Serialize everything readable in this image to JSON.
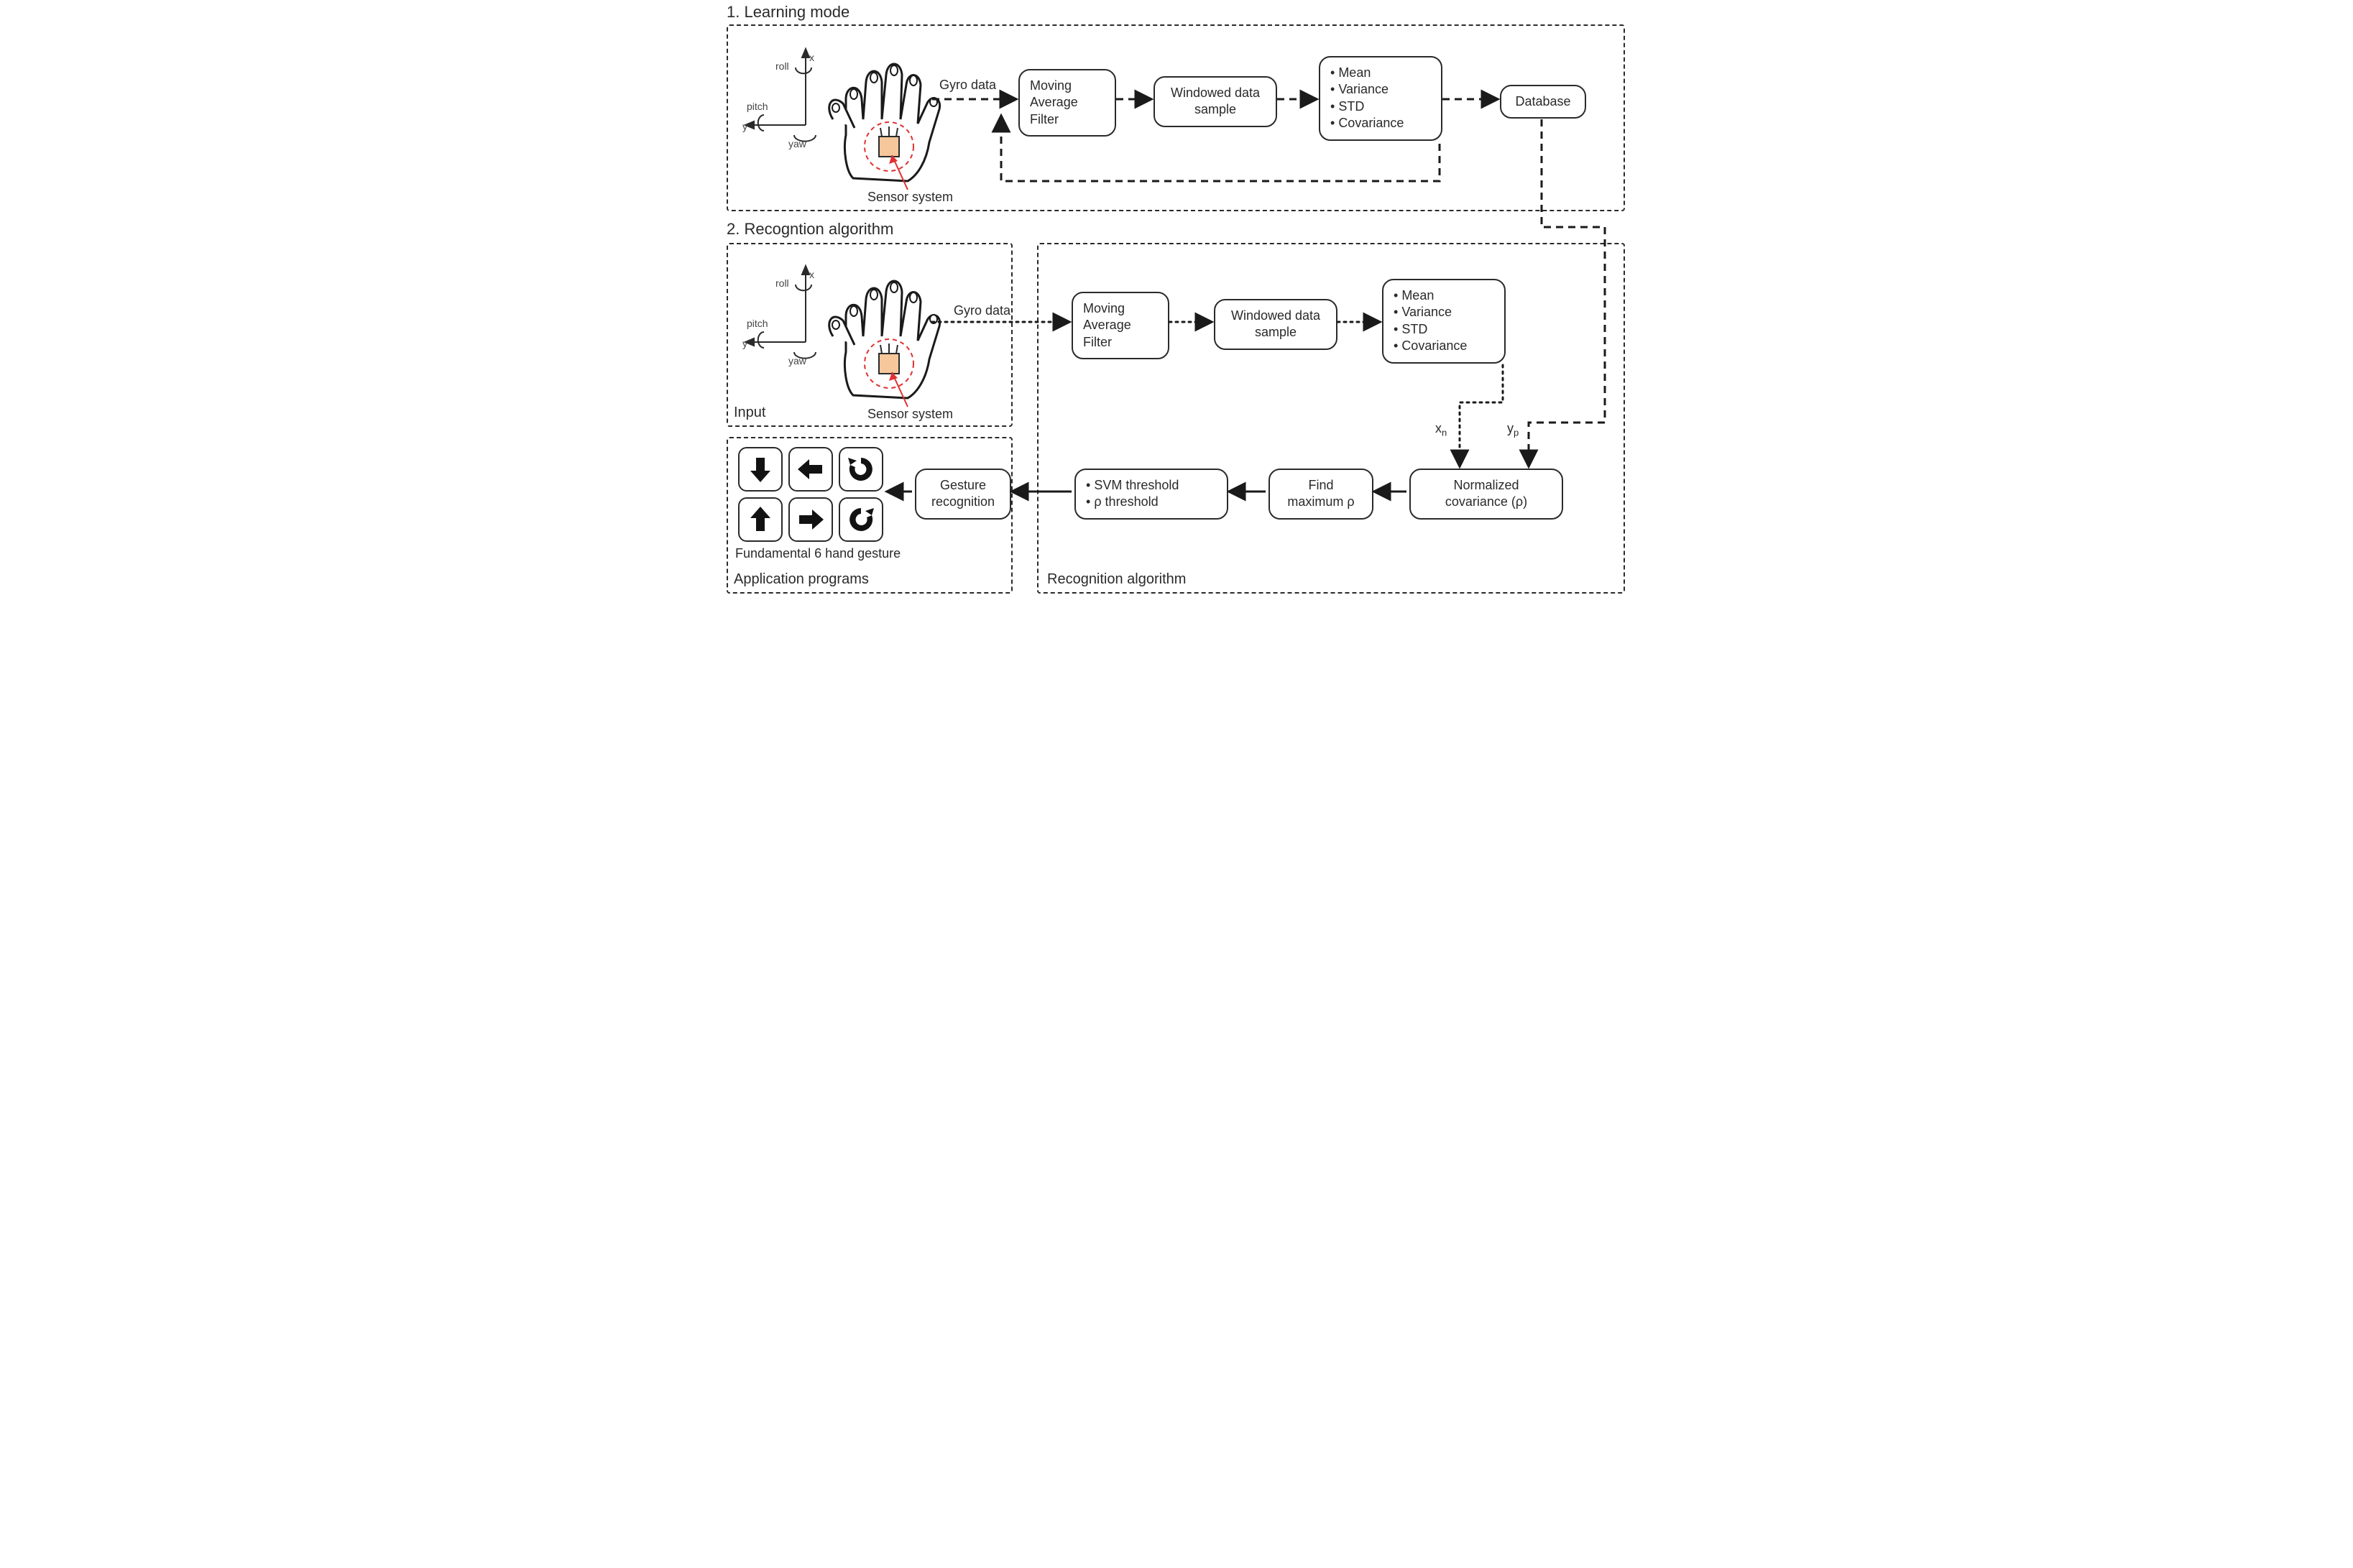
{
  "section1_title": "1. Learning mode",
  "section2_title": "2. Recogntion algorithm",
  "axis": {
    "x": "x",
    "y": "y",
    "roll": "roll",
    "pitch": "pitch",
    "yaw": "yaw"
  },
  "sensor_system_label": "Sensor system",
  "gyro_data_label": "Gyro data",
  "maf_box": "Moving Average Filter",
  "windowed_box": "Windowed data sample",
  "features_box": {
    "mean": "Mean",
    "variance": "Variance",
    "std": "STD",
    "cov": "Covariance"
  },
  "database_box": "Database",
  "input_region_label": "Input",
  "xn_label": {
    "base": "x",
    "sub": "n"
  },
  "yp_label": {
    "base": "y",
    "sub": "p"
  },
  "norm_cov_box": "Normalized covariance (ρ)",
  "find_max_box": "Find maximum ρ",
  "threshold_box": {
    "svm": "SVM threshold",
    "rho": "ρ threshold"
  },
  "gesture_recognition_box": "Gesture recognition",
  "fundamental_label": "Fundamental 6 hand gesture",
  "app_region_label": "Application programs",
  "recog_region_label": "Recognition algorithm"
}
